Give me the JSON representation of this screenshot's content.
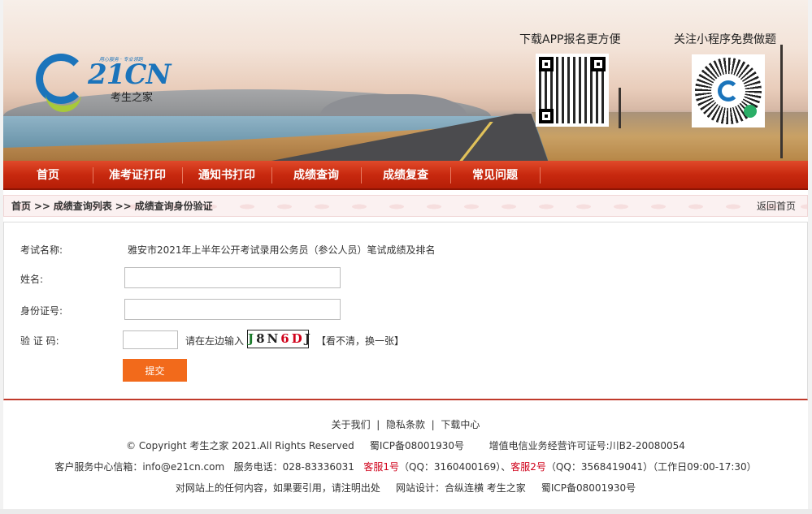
{
  "banner": {
    "logo_slogan": "用心服务 · 专业领跑",
    "logo_text": "21CN",
    "logo_sub": "考生之家",
    "app_title": "下载APP报名更方便",
    "mini_title": "关注小程序免费做题"
  },
  "nav": {
    "items": [
      "首页",
      "准考证打印",
      "通知书打印",
      "成绩查询",
      "成绩复查",
      "常见问题"
    ]
  },
  "breadcrumb": {
    "home": "首页",
    "sep": ">>",
    "list": "成绩查询列表",
    "current": "成绩查询身份验证",
    "back": "返回首页"
  },
  "form": {
    "exam_label": "考试名称:",
    "exam_value": "雅安市2021年上半年公开考试录用公务员（参公人员）笔试成绩及排名",
    "name_label": "姓名:",
    "name_value": "",
    "id_label": "身份证号:",
    "id_value": "",
    "captcha_label": "验 证 码:",
    "captcha_value": "",
    "captcha_hint": "请在左边输入",
    "captcha_chars": [
      {
        "ch": "J",
        "color": "#1a7a2a"
      },
      {
        "ch": "8",
        "color": "#222222"
      },
      {
        "ch": "N",
        "color": "#222222"
      },
      {
        "ch": "6",
        "color": "#d0021b"
      },
      {
        "ch": "D",
        "color": "#d0021b"
      },
      {
        "ch": "J",
        "color": "#222222"
      }
    ],
    "captcha_refresh": "【看不清，换一张】",
    "submit": "提交"
  },
  "footer": {
    "links": [
      "关于我们",
      "隐私条款",
      "下载中心"
    ],
    "link_sep": "|",
    "copyright": "© Copyright 考生之家 2021.All Rights Reserved",
    "icp": "蜀ICP备08001930号",
    "license": "增值电信业务经营许可证号:川B2-20080054",
    "service_mail": "客户服务中心信箱：info@e21cn.com",
    "service_phone": "服务电话：028-83336031",
    "kf1": "客服1号",
    "kf1_qq": "（QQ：3160400169）、",
    "kf2": "客服2号",
    "kf2_qq": "（QQ：3568419041）（工作日09:00-17:30）",
    "notice": "对网站上的任何内容，如果要引用，请注明出处",
    "design": "网站设计：合纵连横 考生之家",
    "icp2": "蜀ICP备08001930号"
  },
  "colors": {
    "nav_red": "#c8290f",
    "submit_orange": "#f26a1b",
    "link_red": "#d0021b",
    "brand_blue": "#1b74bb"
  }
}
